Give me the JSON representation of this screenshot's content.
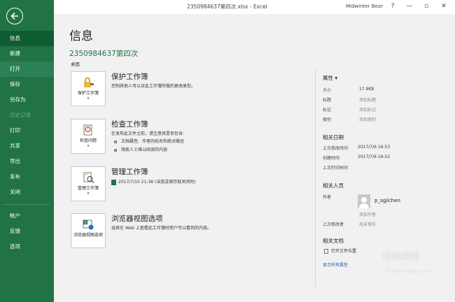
{
  "titlebar": {
    "title": "2350984637第四次.xlsx  -  Excel",
    "user": "Midwinter Bear",
    "help": "?",
    "minimize": "—",
    "maximize": "▫",
    "close": "✕"
  },
  "sidebar": {
    "items": [
      {
        "label": "信息",
        "state": "active"
      },
      {
        "label": "新建"
      },
      {
        "label": "打开",
        "state": "hover"
      },
      {
        "label": "保存"
      },
      {
        "label": "另存为"
      },
      {
        "label": "历史记录",
        "state": "disabled"
      },
      {
        "label": "打印"
      },
      {
        "label": "共享"
      },
      {
        "label": "导出"
      },
      {
        "label": "发布"
      },
      {
        "label": "关闭"
      },
      {
        "label": "帐户"
      },
      {
        "label": "反馈"
      },
      {
        "label": "选项"
      }
    ]
  },
  "main": {
    "title": "信息",
    "file_name": "2350984637第四次",
    "location": "桌面",
    "sections": [
      {
        "button_label": "保护工作簿",
        "title": "保护工作簿",
        "desc": "控制其他人可以对此工作簿所做的更改类型。"
      },
      {
        "button_label": "检查问题",
        "title": "检查工作簿",
        "desc": "在发布此文件之前，请注意其是否包含:",
        "bullets": [
          "文档属性、作者的姓名和绝对路径",
          "残疾人士难以阅读的内容"
        ]
      },
      {
        "button_label": "管理工作簿",
        "title": "管理工作簿",
        "desc": "2017/7/10 21:38 (当我没保存就关闭时)"
      },
      {
        "button_label": "浏览器视图选项",
        "title": "浏览器视图选项",
        "desc": "选择在 Web 上查看此工作簿时用户可以看到的内容。"
      }
    ]
  },
  "properties": {
    "header": "属性 ▾",
    "rows": [
      {
        "key": "大小",
        "value": "17.9KB"
      },
      {
        "key": "标题",
        "value": "添加标题",
        "muted": true
      },
      {
        "key": "标记",
        "value": "添加标记",
        "muted": true
      },
      {
        "key": "类别",
        "value": "添加类别",
        "muted": true
      }
    ],
    "dates_header": "相关日期",
    "dates": [
      {
        "key": "上次修改时间",
        "value": "2017/7/6 16:53"
      },
      {
        "key": "创建时间",
        "value": "2017/7/6 16:52"
      },
      {
        "key": "上次打印时间",
        "value": ""
      }
    ],
    "people_header": "相关人员",
    "author_label": "作者",
    "author_name": "p_sgjlchen",
    "add_author": "添加作者",
    "last_modified_by_label": "上次修改者",
    "last_modified_by": "尚未保存",
    "docs_header": "相关文档",
    "open_location": "打开文件位置",
    "show_all": "显示所有属性"
  },
  "watermark": {
    "main": "搜狗指南",
    "sub": "zhinan.sogou.com"
  },
  "colors": {
    "accent": "#217346",
    "active": "#0e5c31",
    "link": "#1f5fb0"
  }
}
